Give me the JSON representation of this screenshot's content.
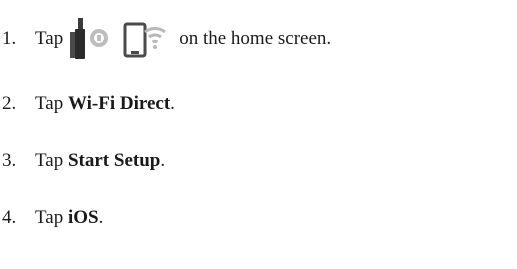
{
  "steps": [
    {
      "number": "1.",
      "before": "Tap",
      "icons": [
        "wireless-router-icon",
        "phone-wifi-icon"
      ],
      "after": "on the home screen."
    },
    {
      "number": "2.",
      "before": "Tap",
      "bold": "Wi-Fi Direct",
      "after": "."
    },
    {
      "number": "3.",
      "before": "Tap",
      "bold": "Start Setup",
      "after": "."
    },
    {
      "number": "4.",
      "before": "Tap",
      "bold": "iOS",
      "after": "."
    }
  ]
}
